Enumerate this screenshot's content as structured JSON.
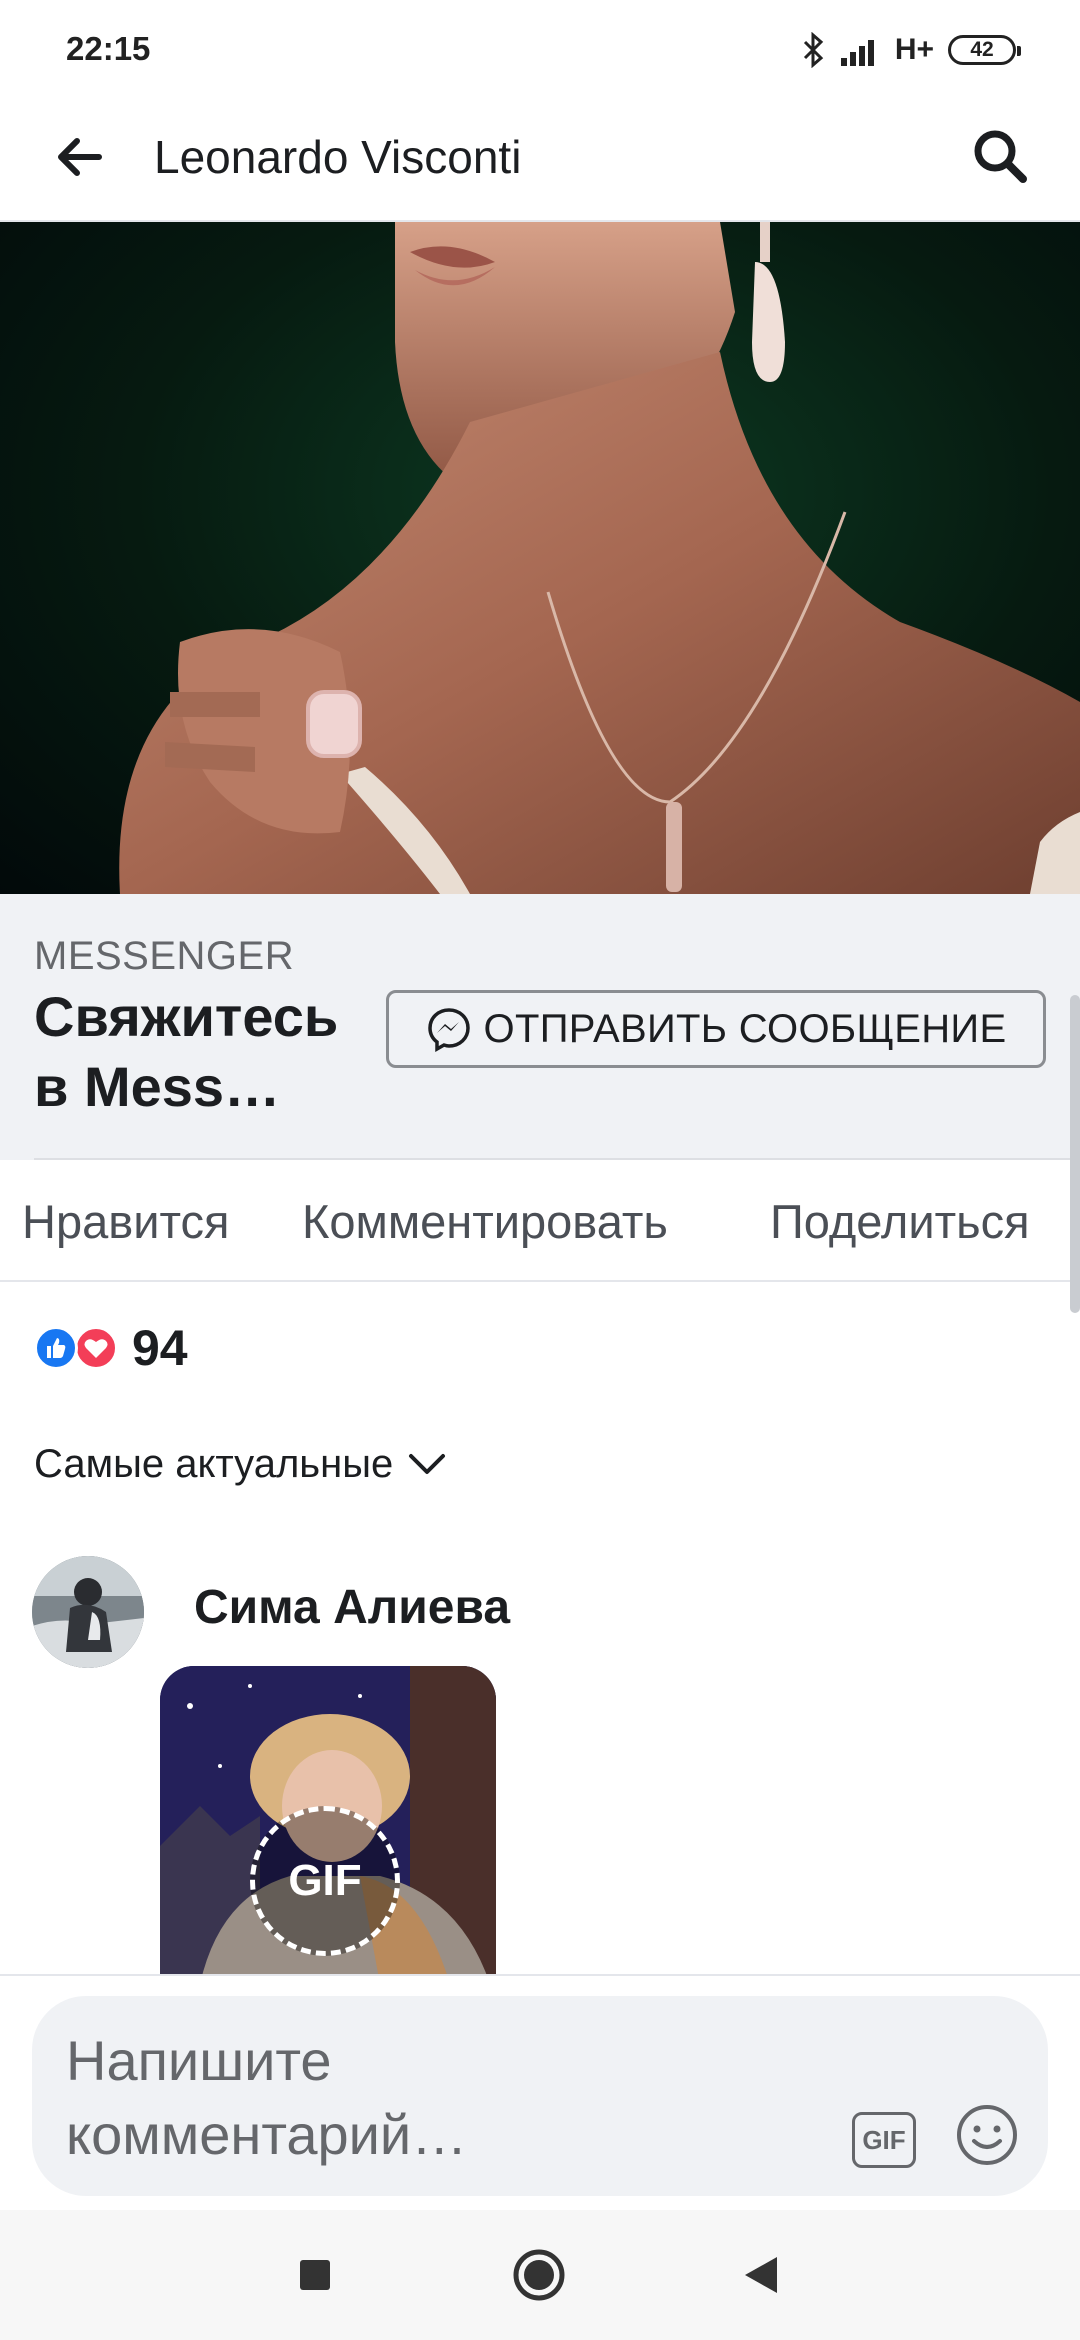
{
  "status_bar": {
    "time": "22:15",
    "network": "H+",
    "battery": "42"
  },
  "header": {
    "title": "Leonardo Visconti"
  },
  "cta": {
    "kicker": "MESSENGER",
    "title": "Свяжитесь в Mess…",
    "button_label": "ОТПРАВИТЬ СООБЩЕНИЕ"
  },
  "actions": {
    "like": "Нравится",
    "comment": "Комментировать",
    "share": "Поделиться"
  },
  "reactions": {
    "count": "94"
  },
  "sort": {
    "label": "Самые актуальные"
  },
  "comment": {
    "author": "Сима Алиева",
    "gif_label": "GIF"
  },
  "composer": {
    "placeholder": "Напишите комментарий…",
    "gif_label": "GIF"
  },
  "colors": {
    "accent": "#1877f2",
    "love": "#f33e58"
  }
}
